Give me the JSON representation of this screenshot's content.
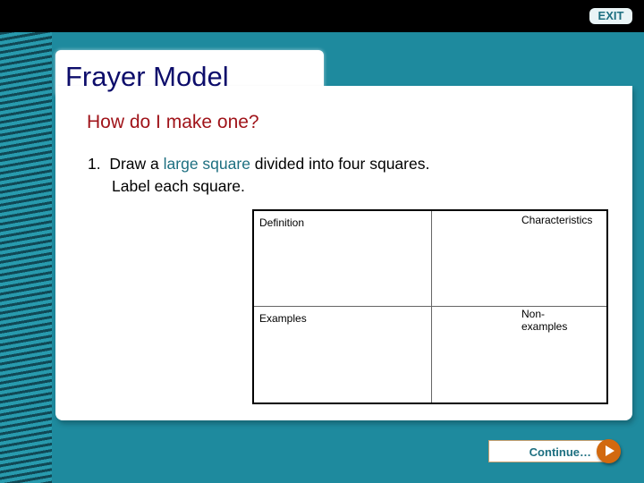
{
  "nav": {
    "exit_label": "EXIT",
    "continue_label": "Continue…"
  },
  "slide": {
    "title": "Frayer Model",
    "question": "How do I make one?",
    "step_number": "1.",
    "step_pre": "Draw a ",
    "step_highlight": "large square",
    "step_post": " divided into four squares.",
    "step_line2": "Label each square."
  },
  "frayer": {
    "definition": "Definition",
    "characteristics": "Characteristics",
    "examples": "Examples",
    "non_examples_1": "Non-",
    "non_examples_2": "examples"
  },
  "colors": {
    "teal": "#1e8a9e",
    "title": "#0d0d6b",
    "question": "#a0141a",
    "play": "#d2690f"
  }
}
